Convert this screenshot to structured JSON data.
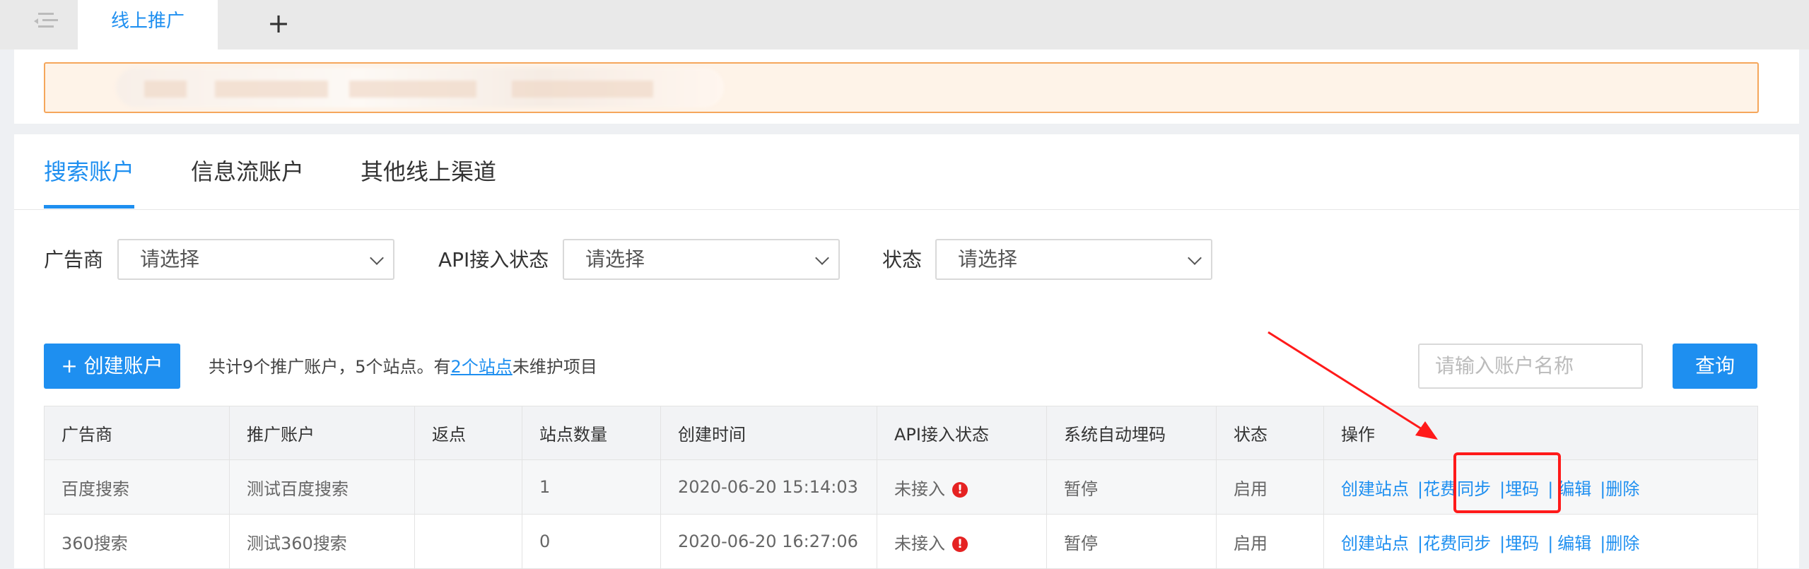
{
  "tabs": {
    "active_tab": "线上推广",
    "add_icon": "+"
  },
  "account_tabs": [
    "搜索账户",
    "信息流账户",
    "其他线上渠道"
  ],
  "filters": [
    {
      "label": "广告商",
      "placeholder": "请选择"
    },
    {
      "label": "API接入状态",
      "placeholder": "请选择"
    },
    {
      "label": "状态",
      "placeholder": "请选择"
    }
  ],
  "toolbar": {
    "create_button": "+ 创建账户",
    "summary_prefix": "共计9个推广账户，5个站点。有",
    "summary_link": "2个站点",
    "summary_suffix": "未维护项目",
    "search_placeholder": "请输入账户名称",
    "search_button": "查询"
  },
  "table": {
    "headers": [
      "广告商",
      "推广账户",
      "返点",
      "站点数量",
      "创建时间",
      "API接入状态",
      "系统自动埋码",
      "状态",
      "操作"
    ],
    "rows": [
      {
        "advertiser": "百度搜索",
        "account": "测试百度搜索",
        "rebate": "",
        "sites": "1",
        "created": "2020-06-20 15:14:03",
        "api_status": "未接入",
        "auto_code": "暂停",
        "status": "启用"
      },
      {
        "advertiser": "360搜索",
        "account": "测试360搜索",
        "rebate": "",
        "sites": "0",
        "created": "2020-06-20 16:27:06",
        "api_status": "未接入",
        "auto_code": "暂停",
        "status": "启用"
      }
    ],
    "actions": [
      "创建站点",
      "花费同步",
      "埋码",
      "编辑",
      "删除"
    ],
    "separator": "|"
  },
  "colors": {
    "accent": "#1e8ff0",
    "danger": "#e52222",
    "annotation": "#ff1a1a"
  },
  "icons": [
    "menu-collapse-icon",
    "plus-icon",
    "chevron-down-icon",
    "alert-icon"
  ]
}
